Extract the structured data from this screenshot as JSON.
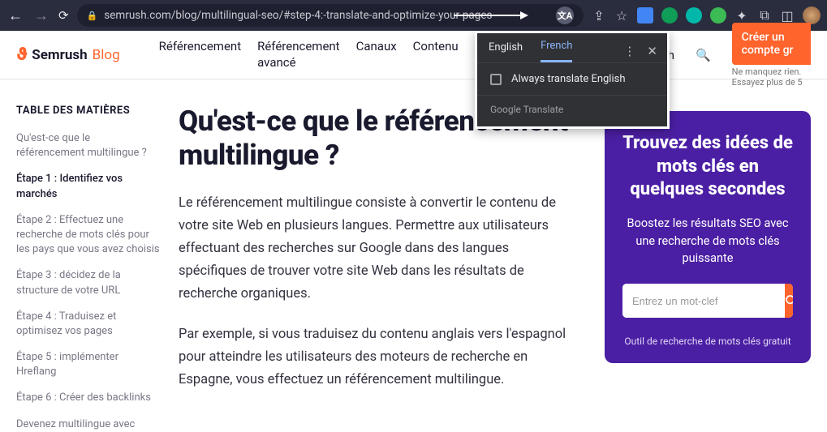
{
  "browser": {
    "url": "semrush.com/blog/multilingual-seo/#step-4:-translate-and-optimize-your-pages",
    "translate_badge": "文A"
  },
  "translate_popup": {
    "tabs": {
      "english": "English",
      "french": "French"
    },
    "always": "Always translate English",
    "footer": "Google Translate"
  },
  "header": {
    "brand": "Semrush",
    "brand_suffix": "Blog",
    "nav": {
      "referencement": "Référencement",
      "referencement_avance_l1": "Référencement",
      "referencement_avance_l2": "avancé",
      "canaux": "Canaux",
      "contenu": "Contenu",
      "hidden_tail": "h"
    },
    "cta": "Créer un compte gr",
    "sub": "Ne manquez rien. Essayez plus de 5"
  },
  "toc": {
    "title": "TABLE DES MATIÈRES",
    "items": [
      "Qu'est-ce que le référencement multilingue ?",
      "Étape 1 : Identifiez vos marchés",
      "Étape 2 : Effectuez une recherche de mots clés pour les pays que vous avez choisis",
      "Étape 3 : décidez de la structure de votre URL",
      "Étape 4 : Traduisez et optimisez vos pages",
      "Étape 5 : implémenter Hreflang",
      "Étape 6 : Créer des backlinks",
      "Devenez multilingue avec"
    ]
  },
  "article": {
    "h1": "Qu'est-ce que le référencement multilingue ?",
    "p1": "Le référencement multilingue consiste à convertir le contenu de votre site Web en plusieurs langues. Permettre aux utilisateurs effectuant des recherches sur Google dans des langues spécifiques de trouver votre site Web dans les résultats de recherche organiques.",
    "p2": "Par exemple, si vous traduisez du contenu anglais vers l'espagnol pour atteindre les utilisateurs des moteurs de recherche en Espagne, vous effectuez un référencement multilingue."
  },
  "promo": {
    "title": "Trouvez des idées de mots clés en quelques secondes",
    "sub": "Boostez les résultats SEO avec une recherche de mots clés puissante",
    "placeholder": "Entrez un mot-clef",
    "footer": "Outil de recherche de mots clés gratuit"
  },
  "ext_colors": [
    "#4285f4",
    "#0f9d58",
    "#00c4b4",
    "#34a853",
    "#5f6368",
    "#8ab4f8",
    "#bdc1c6",
    "#5f6368"
  ]
}
